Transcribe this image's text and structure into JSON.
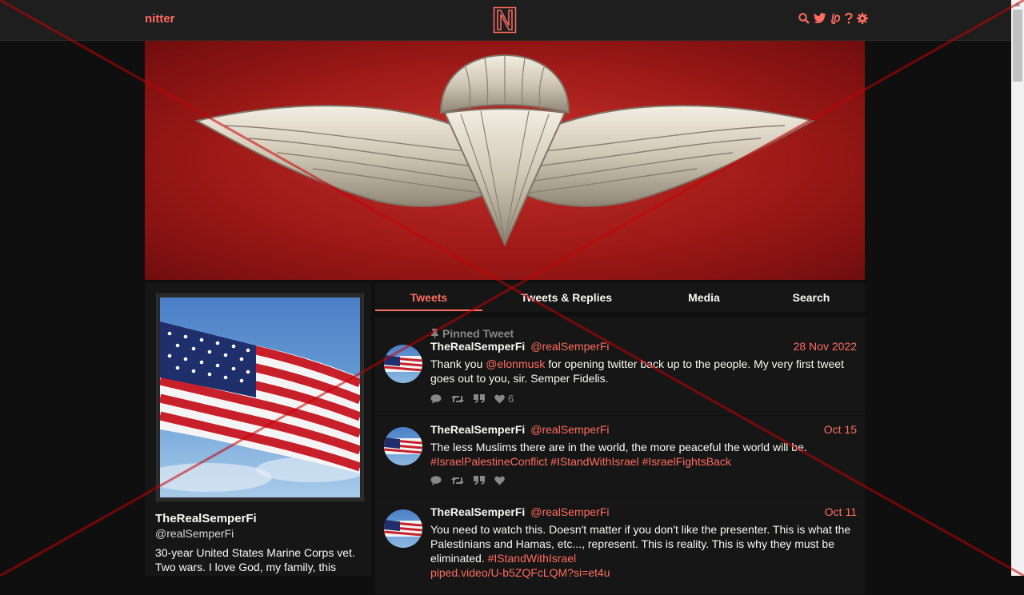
{
  "nav": {
    "brand": "nitter",
    "logo_letter": "N",
    "icons": [
      "search-icon",
      "twitter-bird-icon",
      "liberapay-icon",
      "help-icon",
      "settings-icon"
    ]
  },
  "profile": {
    "name": "TheRealSemperFi",
    "handle": "@realSemperFi",
    "bio": "30-year United States Marine Corps vet. Two wars. I love God, my family, this"
  },
  "tabs": [
    {
      "label": "Tweets",
      "active": true
    },
    {
      "label": "Tweets & Replies",
      "active": false
    },
    {
      "label": "Media",
      "active": false
    },
    {
      "label": "Search",
      "active": false
    }
  ],
  "tweets": [
    {
      "pinned_label": "Pinned Tweet",
      "name": "TheRealSemperFi",
      "handle": "@realSemperFi",
      "date": "28 Nov 2022",
      "text_before": "Thank you ",
      "mention": "@elonmusk",
      "text_after": " for opening twitter back up to the people. My very first tweet goes out to you, sir. Semper Fidelis.",
      "likes": "6"
    },
    {
      "name": "TheRealSemperFi",
      "handle": "@realSemperFi",
      "date": "Oct 15",
      "text": "The less Muslims there are in the world, the more peaceful the world will be.",
      "hashtags": "#IsraelPalestineConflict #IStandWithIsrael  #IsraelFightsBack",
      "likes": ""
    },
    {
      "name": "TheRealSemperFi",
      "handle": "@realSemperFi",
      "date": "Oct 11",
      "text": "You need to watch this. Doesn't matter if you don't like the presenter. This is what the Palestinians and Hamas, etc..., represent. This is reality. This is why they must be eliminated. ",
      "hashtag": "#IStandWithIsrael",
      "link": "piped.video/U-b5ZQFcLQM?si=et4u"
    }
  ],
  "colors": {
    "accent": "#ff6c60",
    "background": "#0f0f0f",
    "panel": "#161616",
    "navbar": "#1e1e1e",
    "banner_red": "#b3201d",
    "overlay_cross": "#c80000"
  }
}
